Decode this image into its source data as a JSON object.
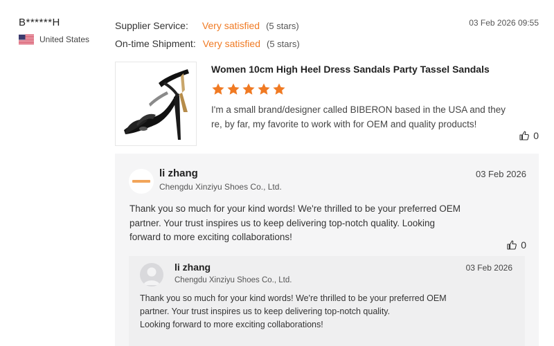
{
  "review": {
    "reviewer_name": "B******H",
    "country": "United States",
    "date": "03 Feb 2026 09:55",
    "ratings": [
      {
        "label": "Supplier Service:",
        "value": "Very satisfied",
        "stars_text": "(5 stars)"
      },
      {
        "label": "On-time Shipment:",
        "value": "Very satisfied",
        "stars_text": "(5 stars)"
      }
    ],
    "product_title": "Women 10cm High Heel Dress Sandals Party Tassel Sandals",
    "star_rating": 5,
    "text_line1": "I'm a small brand/designer called BIBERON based in the USA and they",
    "text_line2": "re, by far, my favorite to work with for OEM and quality products!",
    "like_count": "0"
  },
  "reply": {
    "name": "li zhang",
    "company": "Chengdu Xinziyu Shoes Co., Ltd.",
    "date": "03 Feb 2026",
    "text_line1": "Thank you so much for your kind words! We're thrilled to be your preferred OEM",
    "text_line2": "partner. Your trust inspires us to keep delivering top-notch quality. Looking",
    "text_line3": "forward to more exciting collaborations!",
    "like_count": "0"
  },
  "nested_reply": {
    "name": "li zhang",
    "company": "Chengdu Xinziyu Shoes Co., Ltd.",
    "date": "03 Feb 2026",
    "text_line1": "Thank you so much for your kind words! We're thrilled to be your preferred OEM",
    "text_line2": "partner. Your trust inspires us to keep delivering top-notch quality.",
    "text_line3": "Looking forward to more exciting collaborations!"
  },
  "colors": {
    "accent_orange": "#f07a23",
    "reply_bg": "#f5f5f6",
    "nested_bg": "#efeff0"
  },
  "icons": {
    "flag": "us-flag-icon",
    "like": "thumbs-up-icon",
    "star": "star-icon"
  }
}
